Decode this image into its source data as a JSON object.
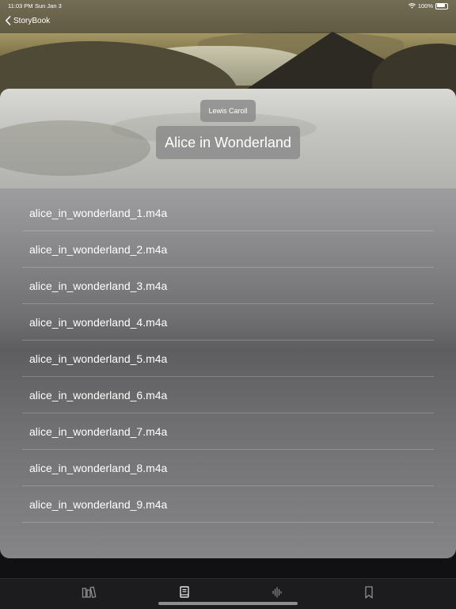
{
  "status": {
    "time": "11:03 PM",
    "date": "Sun Jan 3",
    "battery": "100%"
  },
  "nav": {
    "back_label": "StoryBook"
  },
  "book": {
    "author": "Lewis Caroll",
    "title": "Alice in Wonderland"
  },
  "tracks": [
    "alice_in_wonderland_1.m4a",
    "alice_in_wonderland_2.m4a",
    "alice_in_wonderland_3.m4a",
    "alice_in_wonderland_4.m4a",
    "alice_in_wonderland_5.m4a",
    "alice_in_wonderland_6.m4a",
    "alice_in_wonderland_7.m4a",
    "alice_in_wonderland_8.m4a",
    "alice_in_wonderland_9.m4a"
  ],
  "tabs": [
    {
      "icon": "library-icon",
      "active": false
    },
    {
      "icon": "book-icon",
      "active": true
    },
    {
      "icon": "waveform-icon",
      "active": false
    },
    {
      "icon": "bookmark-icon",
      "active": false
    }
  ],
  "colors": {
    "tab_active": "#e5e5e7",
    "tab_inactive": "#8e8e93"
  }
}
